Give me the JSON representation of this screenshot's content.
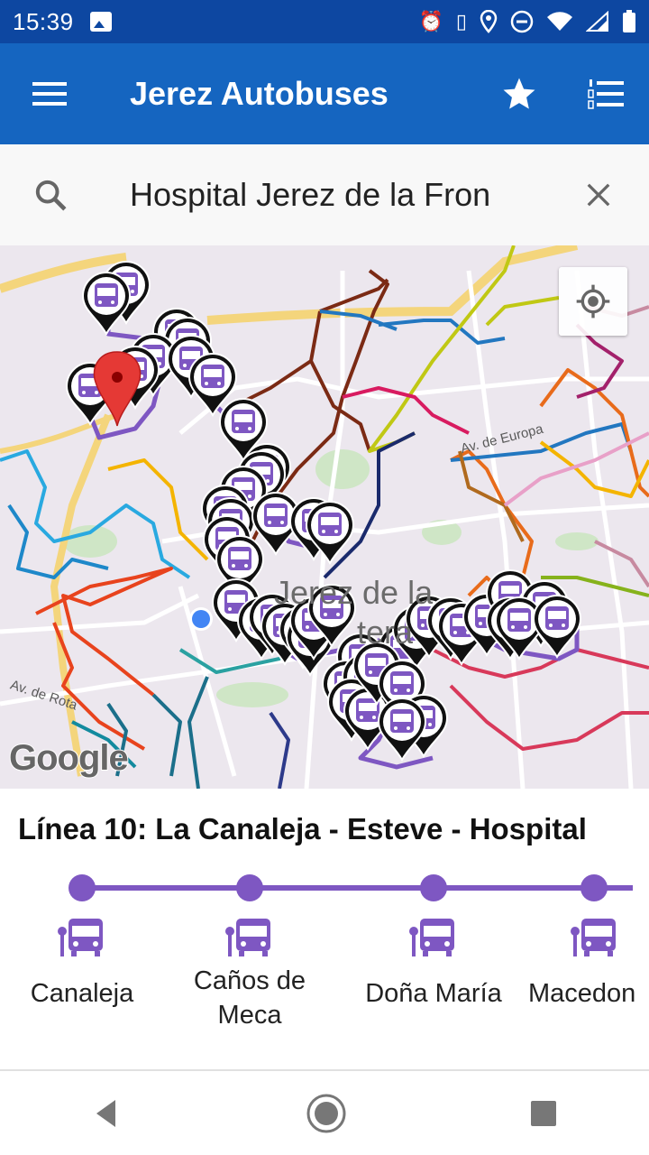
{
  "status_bar": {
    "time": "15:39"
  },
  "app_bar": {
    "title": "Jerez Autobuses",
    "icons": [
      "menu-icon",
      "star-icon",
      "numbered-list-icon"
    ]
  },
  "search": {
    "value": "Hospital Jerez de la Fron",
    "icons": [
      "search-icon",
      "close-icon"
    ]
  },
  "map": {
    "labels": {
      "avenue_europa": "Av. de Europa",
      "avenue_rota": "Av. de Rota",
      "city_line1": "Jerez de la",
      "city_line2": "tera"
    },
    "attribution": "Google",
    "route_color": "#7e57c2"
  },
  "line": {
    "title": "Línea 10: La Canaleja - Esteve - Hospital",
    "stops": [
      {
        "name": "Canaleja"
      },
      {
        "name": "Caños de\nMeca"
      },
      {
        "name": "Doña María"
      },
      {
        "name": "Macedon"
      }
    ]
  },
  "nav": {
    "icons": [
      "back-icon",
      "home-icon",
      "recents-icon"
    ]
  }
}
